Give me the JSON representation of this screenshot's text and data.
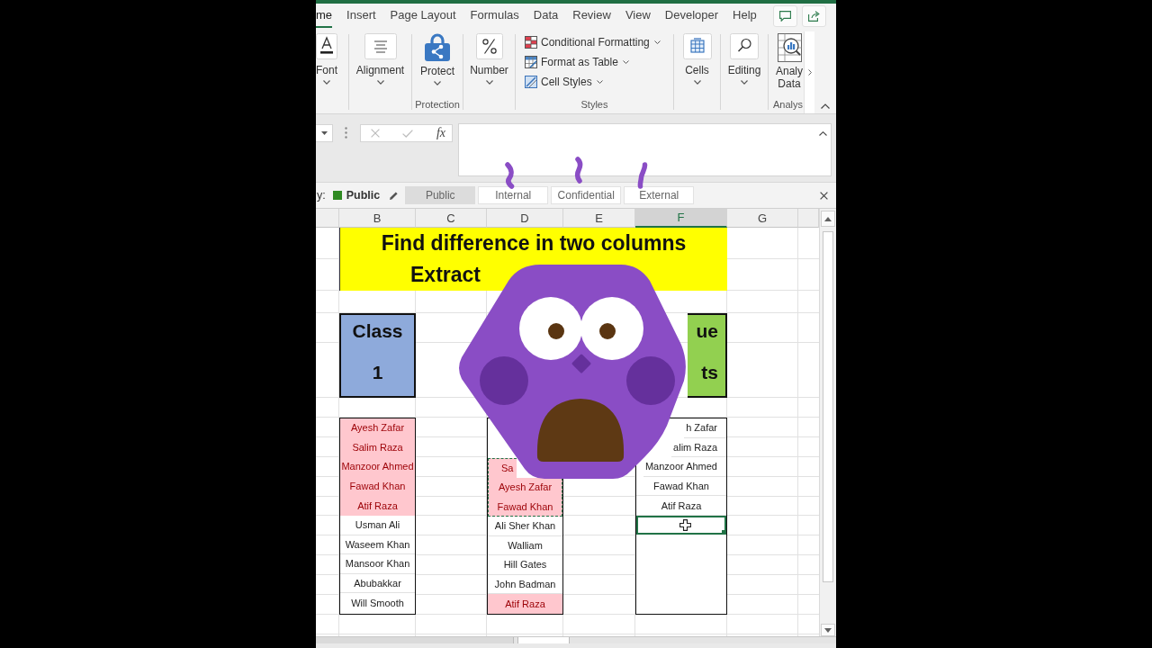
{
  "ribbon_tabs": [
    {
      "label": "me",
      "selected": true
    },
    {
      "label": "Insert",
      "selected": false
    },
    {
      "label": "Page Layout",
      "selected": false
    },
    {
      "label": "Formulas",
      "selected": false
    },
    {
      "label": "Data",
      "selected": false
    },
    {
      "label": "Review",
      "selected": false
    },
    {
      "label": "View",
      "selected": false
    },
    {
      "label": "Developer",
      "selected": false
    },
    {
      "label": "Help",
      "selected": false
    }
  ],
  "ribbon": {
    "font": {
      "label": "Font"
    },
    "alignment": {
      "label": "Alignment"
    },
    "protection": {
      "button": "Protect",
      "group_label": "Protection"
    },
    "number": {
      "label": "Number"
    },
    "styles": {
      "commands": [
        "Conditional Formatting",
        "Format as Table",
        "Cell Styles"
      ],
      "group_label": "Styles"
    },
    "cells": {
      "label": "Cells"
    },
    "editing": {
      "label": "Editing"
    },
    "analysis": {
      "button_lines": [
        "Analy",
        "Data"
      ],
      "group_label": "Analys"
    }
  },
  "formula_bar": {
    "buttons": [
      {
        "kind": "cancel",
        "disabled": true
      },
      {
        "kind": "enter",
        "disabled": true
      },
      {
        "kind": "function",
        "label": "fx",
        "disabled": false
      }
    ]
  },
  "sensitivity_bar": {
    "prefix": "y:",
    "current": "Public",
    "options": [
      {
        "label": "Public",
        "selected": true
      },
      {
        "label": "Internal",
        "selected": false
      },
      {
        "label": "Confidential",
        "selected": false
      },
      {
        "label": "External",
        "selected": false
      }
    ]
  },
  "sheet": {
    "columns": [
      {
        "letter": "B",
        "selected": false
      },
      {
        "letter": "C",
        "selected": false
      },
      {
        "letter": "D",
        "selected": false
      },
      {
        "letter": "E",
        "selected": false
      },
      {
        "letter": "F",
        "selected": true
      },
      {
        "letter": "G",
        "selected": false
      }
    ],
    "title_lines": [
      {
        "text": "Find difference in two columns",
        "partly_hidden": false
      },
      {
        "text": "Extract",
        "partly_hidden": true
      }
    ],
    "header_boxes": [
      {
        "color": "#8eaadb",
        "partly_hidden": false,
        "lines": [
          "Class",
          "1"
        ]
      },
      {
        "color": "#92d050",
        "partly_hidden": true,
        "lines": [
          "ue",
          "ts"
        ]
      }
    ],
    "lists": [
      {
        "cells": [
          {
            "text": "Ayesh Zafar",
            "highlighted": true,
            "selected": false,
            "partly_hidden": false
          },
          {
            "text": "Salim Raza",
            "highlighted": true,
            "selected": false,
            "partly_hidden": false
          },
          {
            "text": "Manzoor Ahmed",
            "highlighted": true,
            "selected": false,
            "partly_hidden": false
          },
          {
            "text": "Fawad Khan",
            "highlighted": true,
            "selected": false,
            "partly_hidden": false
          },
          {
            "text": "Atif Raza",
            "highlighted": true,
            "selected": false,
            "partly_hidden": false
          },
          {
            "text": "Usman Ali",
            "highlighted": false,
            "selected": false,
            "partly_hidden": false
          },
          {
            "text": "Waseem Khan",
            "highlighted": false,
            "selected": false,
            "partly_hidden": false
          },
          {
            "text": "Mansoor Khan",
            "highlighted": false,
            "selected": false,
            "partly_hidden": false
          },
          {
            "text": "Abubakkar",
            "highlighted": false,
            "selected": false,
            "partly_hidden": false
          },
          {
            "text": "Will Smooth",
            "highlighted": false,
            "selected": false,
            "partly_hidden": false
          }
        ]
      },
      {
        "cells": [
          {
            "text": "Sa",
            "highlighted": true,
            "selected": false,
            "copied": true,
            "partly_hidden": true
          },
          {
            "text": "Ayesh Zafar",
            "highlighted": true,
            "selected": false,
            "copied": true,
            "partly_hidden": false
          },
          {
            "text": "Fawad Khan",
            "highlighted": true,
            "selected": false,
            "copied": true,
            "partly_hidden": false
          },
          {
            "text": "Ali Sher Khan",
            "highlighted": false,
            "selected": false,
            "copied": false,
            "partly_hidden": false
          },
          {
            "text": "Walliam",
            "highlighted": false,
            "selected": false,
            "copied": false,
            "partly_hidden": false
          },
          {
            "text": "Hill Gates",
            "highlighted": false,
            "selected": false,
            "copied": false,
            "partly_hidden": false
          },
          {
            "text": "John Badman",
            "highlighted": false,
            "selected": false,
            "copied": false,
            "partly_hidden": false
          },
          {
            "text": "Atif Raza",
            "highlighted": true,
            "selected": false,
            "copied": false,
            "partly_hidden": false
          }
        ]
      },
      {
        "cells": [
          {
            "text": "h Zafar",
            "highlighted": false,
            "selected": false,
            "partly_hidden": true
          },
          {
            "text": "alim Raza",
            "highlighted": false,
            "selected": false,
            "partly_hidden": true
          },
          {
            "text": "Manzoor Ahmed",
            "highlighted": false,
            "selected": false,
            "partly_hidden": true
          },
          {
            "text": "Fawad Khan",
            "highlighted": false,
            "selected": false,
            "partly_hidden": false
          },
          {
            "text": "Atif Raza",
            "highlighted": false,
            "selected": false,
            "partly_hidden": false
          },
          {
            "highlighted": false,
            "selected": true,
            "partly_hidden": false
          }
        ]
      }
    ]
  }
}
